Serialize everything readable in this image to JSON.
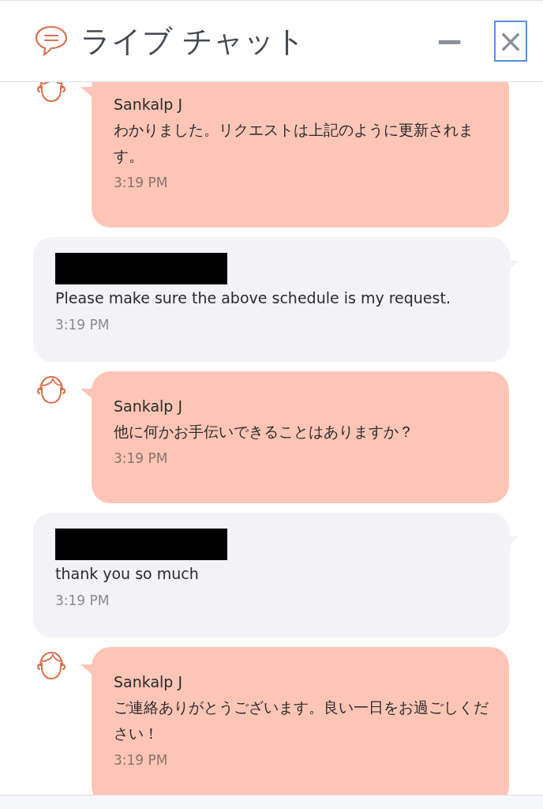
{
  "header": {
    "title": "ライブ チャット",
    "minimize_label": "−",
    "close_label": "×"
  },
  "messages": [
    {
      "kind": "agent",
      "sender": "Sankalp J",
      "text": "わかりました。リクエストは上記のように更新されます。",
      "time": "3:19 PM"
    },
    {
      "kind": "user",
      "redacted": true,
      "text": "Please make sure the above schedule is my request.",
      "time": "3:19 PM"
    },
    {
      "kind": "agent",
      "sender": "Sankalp J",
      "text": "他に何かお手伝いできることはありますか？",
      "time": "3:19 PM"
    },
    {
      "kind": "user",
      "redacted": true,
      "text": "thank you so much",
      "time": "3:19 PM"
    },
    {
      "kind": "agent",
      "sender": "Sankalp J",
      "text": "ご連絡ありがとうございます。良い一日をお過ごしください！",
      "time": "3:19 PM"
    }
  ]
}
